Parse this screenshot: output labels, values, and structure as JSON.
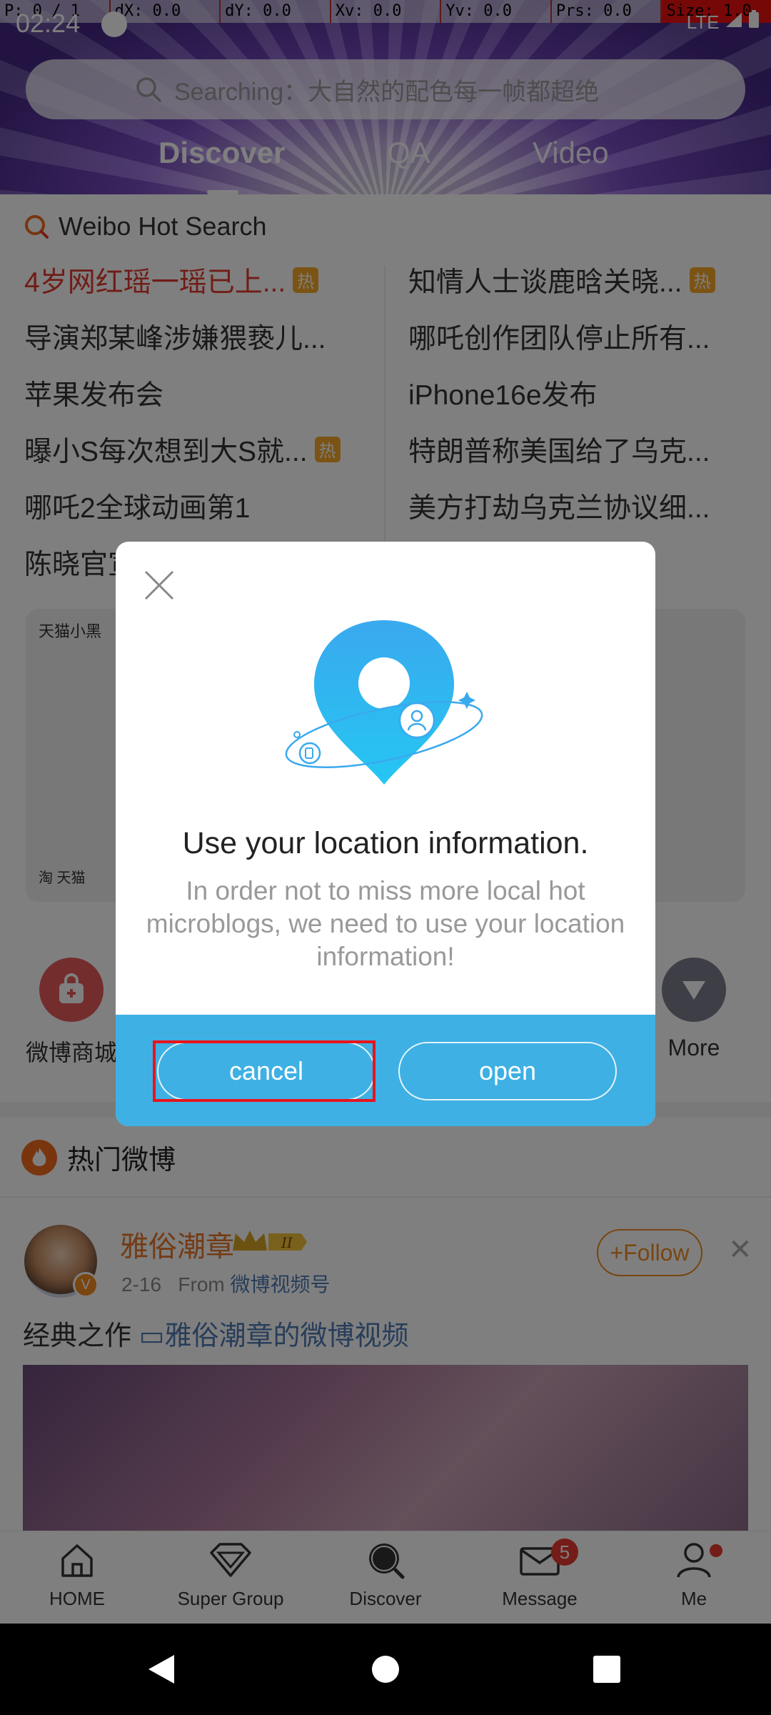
{
  "debug_bar": {
    "pointer": "P: 0 / 1",
    "dx": "dX: 0.0",
    "dy": "dY: 0.0",
    "xv": "Xv: 0.0",
    "yv": "Yv: 0.0",
    "prs": "Prs: 0.0",
    "size": "Size: 1.0"
  },
  "status_bar": {
    "time": "02:24",
    "network": "LTE"
  },
  "search": {
    "placeholder": "Searching：大自然的配色每一帧都超绝"
  },
  "top_tabs": [
    "Discover",
    "QA",
    "Video"
  ],
  "hot_search": {
    "title": "Weibo Hot Search",
    "badge": "热",
    "left": [
      {
        "text": "4岁网红瑶一瑶已上...",
        "hot": true
      },
      {
        "text": "导演郑某峰涉嫌猥亵儿..."
      },
      {
        "text": "苹果发布会"
      },
      {
        "text": "曝小S每次想到大S就...",
        "hot": true
      },
      {
        "text": "哪吒2全球动画第1"
      },
      {
        "text": "陈晓官宣"
      }
    ],
    "right": [
      {
        "text": "知情人士谈鹿晗关晓...",
        "hot": true
      },
      {
        "text": "哪吒创作团队停止所有..."
      },
      {
        "text": "iPhone16e发布"
      },
      {
        "text": "特朗普称美国给了乌克..."
      },
      {
        "text": "美方打劫乌克兰协议细..."
      }
    ]
  },
  "banner": {
    "tag": "天猫小黑",
    "footer_tag": "淘 天猫"
  },
  "quick_links": {
    "mall": "微博商城",
    "more": "More"
  },
  "hot_weibo": {
    "title": "热门微博"
  },
  "post": {
    "username": "雅俗潮章",
    "level": "II",
    "date": "2-16",
    "from_label": "From",
    "source": "微博视频号",
    "follow_label": "+Follow",
    "text": "经典之作",
    "link": "雅俗潮章的微博视频"
  },
  "bottom_nav": [
    {
      "label": "HOME",
      "icon": "home-icon"
    },
    {
      "label": "Super Group",
      "icon": "diamond-icon"
    },
    {
      "label": "Discover",
      "icon": "discover-icon"
    },
    {
      "label": "Message",
      "icon": "mail-icon",
      "badge": "5"
    },
    {
      "label": "Me",
      "icon": "person-icon"
    }
  ],
  "dialog": {
    "title": "Use your location information.",
    "message": "In order not to miss more local hot microblogs, we need to use your location information!",
    "cancel_label": "cancel",
    "open_label": "open"
  },
  "colors": {
    "accent_blue": "#3eb0e4",
    "hot_red": "#e3392f",
    "highlight_red": "#e8141c",
    "follow_orange": "#f08c25"
  }
}
